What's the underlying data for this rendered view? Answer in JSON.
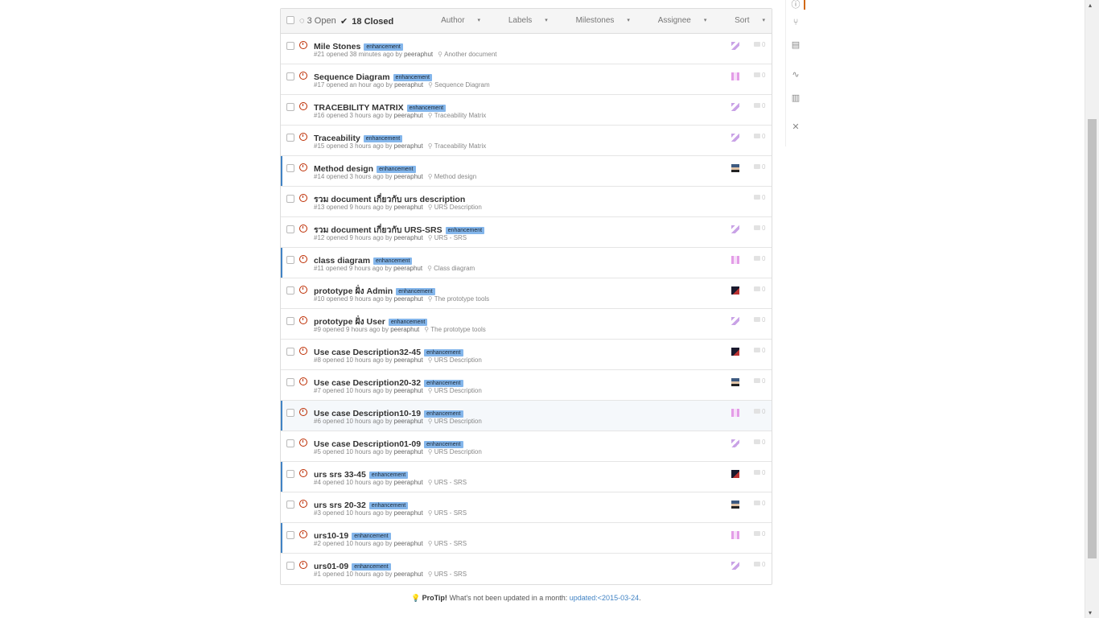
{
  "header": {
    "open_label": "3 Open",
    "closed_label": "18 Closed",
    "check_glyph": "✔",
    "filters": [
      "Author",
      "Labels",
      "Milestones",
      "Assignee",
      "Sort"
    ]
  },
  "label_text": "enhancement",
  "issues": [
    {
      "title": "Mile Stones",
      "labeled": true,
      "meta": "#21 opened 38 minutes ago by",
      "author": "peeraphut",
      "milestone": "Another document",
      "avatar": "purple",
      "comments": "0"
    },
    {
      "title": "Sequence Diagram",
      "labeled": true,
      "meta": "#17 opened an hour ago by",
      "author": "peeraphut",
      "milestone": "Sequence Diagram",
      "avatar": "pink",
      "comments": "0"
    },
    {
      "title": "TRACEBILITY MATRIX",
      "labeled": true,
      "meta": "#16 opened 3 hours ago by",
      "author": "peeraphut",
      "milestone": "Traceability Matrix",
      "avatar": "purple",
      "comments": "0"
    },
    {
      "title": "Traceability",
      "labeled": true,
      "meta": "#15 opened 3 hours ago by",
      "author": "peeraphut",
      "milestone": "Traceability Matrix",
      "avatar": "purple",
      "comments": "0"
    },
    {
      "title": "Method design",
      "labeled": true,
      "meta": "#14 opened 3 hours ago by",
      "author": "peeraphut",
      "milestone": "Method design",
      "avatar": "photo",
      "comments": "0"
    },
    {
      "title": "รวม document เกี่ยวกับ urs description",
      "labeled": false,
      "meta": "#13 opened 9 hours ago by",
      "author": "peeraphut",
      "milestone": "URS Description",
      "avatar": "none",
      "comments": "0"
    },
    {
      "title": "รวม document เกี่ยวกับ URS-SRS",
      "labeled": true,
      "meta": "#12 opened 9 hours ago by",
      "author": "peeraphut",
      "milestone": "URS - SRS",
      "avatar": "purple",
      "comments": "0"
    },
    {
      "title": "class diagram",
      "labeled": true,
      "meta": "#11 opened 9 hours ago by",
      "author": "peeraphut",
      "milestone": "Class diagram",
      "avatar": "pink",
      "comments": "0"
    },
    {
      "title": "prototype ฝั่ง Admin",
      "labeled": true,
      "meta": "#10 opened 9 hours ago by",
      "author": "peeraphut",
      "milestone": "The prototype tools",
      "avatar": "dark",
      "comments": "0"
    },
    {
      "title": "prototype ฝั่ง User",
      "labeled": true,
      "meta": "#9 opened 9 hours ago by",
      "author": "peeraphut",
      "milestone": "The prototype tools",
      "avatar": "purple",
      "comments": "0"
    },
    {
      "title": "Use case Description32-45",
      "labeled": true,
      "meta": "#8 opened 10 hours ago by",
      "author": "peeraphut",
      "milestone": "URS Description",
      "avatar": "dark",
      "comments": "0"
    },
    {
      "title": "Use case Description20-32",
      "labeled": true,
      "meta": "#7 opened 10 hours ago by",
      "author": "peeraphut",
      "milestone": "URS Description",
      "avatar": "photo",
      "comments": "0"
    },
    {
      "title": "Use case Description10-19",
      "labeled": true,
      "meta": "#6 opened 10 hours ago by",
      "author": "peeraphut",
      "milestone": "URS Description",
      "avatar": "pink",
      "comments": "0"
    },
    {
      "title": "Use case Description01-09",
      "labeled": true,
      "meta": "#5 opened 10 hours ago by",
      "author": "peeraphut",
      "milestone": "URS Description",
      "avatar": "purple",
      "comments": "0"
    },
    {
      "title": "urs srs 33-45",
      "labeled": true,
      "meta": "#4 opened 10 hours ago by",
      "author": "peeraphut",
      "milestone": "URS - SRS",
      "avatar": "dark",
      "comments": "0"
    },
    {
      "title": "urs srs 20-32",
      "labeled": true,
      "meta": "#3 opened 10 hours ago by",
      "author": "peeraphut",
      "milestone": "URS - SRS",
      "avatar": "photo",
      "comments": "0"
    },
    {
      "title": "urs10-19",
      "labeled": true,
      "meta": "#2 opened 10 hours ago by",
      "author": "peeraphut",
      "milestone": "URS - SRS",
      "avatar": "pink",
      "comments": "0"
    },
    {
      "title": "urs01-09",
      "labeled": true,
      "meta": "#1 opened 10 hours ago by",
      "author": "peeraphut",
      "milestone": "URS - SRS",
      "avatar": "purple",
      "comments": "0"
    }
  ],
  "protip": {
    "strong": "ProTip!",
    "text": " What's not been updated in a month: ",
    "link": "updated:<2015-03-24",
    "end": "."
  },
  "colors": {
    "label_bg": "#84b6eb",
    "closed_icon": "#bd2c00",
    "link": "#4183c4",
    "active_tab": "#d26911"
  }
}
